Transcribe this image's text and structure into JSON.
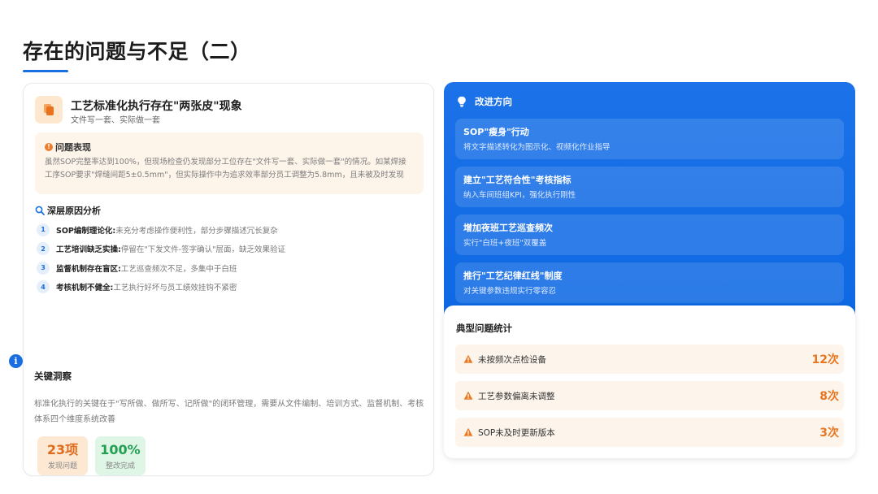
{
  "page": {
    "title": "存在的问题与不足（二）",
    "accent": "#1a6fe0"
  },
  "left_card": {
    "icon": "copy-files-icon",
    "title": "工艺标准化执行存在\"两张皮\"现象",
    "subtitle": "文件写一套、实际做一套",
    "problem": {
      "heading": "问题表现",
      "text": "虽然SOP完整率达到100%，但现场检查仍发现部分工位存在\"文件写一套、实际做一套\"的情况。如某焊接工序SOP要求\"焊缝间距5±0.5mm\"，但实际操作中为追求效率部分员工调整为5.8mm，且未被及时发现"
    },
    "analysis": {
      "heading": "深层原因分析",
      "items": [
        {
          "num": "1",
          "bold": "SOP编制理论化:",
          "desc": "未充分考虑操作便利性，部分步骤描述冗长复杂"
        },
        {
          "num": "2",
          "bold": "工艺培训缺乏实操:",
          "desc": "停留在\"下发文件-签字确认\"层面，缺乏效果验证"
        },
        {
          "num": "3",
          "bold": "监督机制存在盲区:",
          "desc": "工艺巡查频次不足，多集中于白班"
        },
        {
          "num": "4",
          "bold": "考核机制不健全:",
          "desc": "工艺执行好坏与员工绩效挂钩不紧密"
        }
      ]
    },
    "insight": {
      "title": "关键洞察",
      "text": "标准化执行的关键在于\"写所做、做所写、记所做\"的闭环管理，需要从文件编制、培训方式、监督机制、考核体系四个维度系统改善"
    },
    "stats": [
      {
        "value": "23项",
        "label": "发现问题",
        "color": "#e06a1c"
      },
      {
        "value": "100%",
        "label": "整改完成",
        "color": "#21a052"
      }
    ]
  },
  "improve": {
    "heading": "改进方向",
    "icon": "lightbulb-icon",
    "items": [
      {
        "title": "SOP\"瘦身\"行动",
        "desc": "将文字描述转化为图示化、视频化作业指导"
      },
      {
        "title": "建立\"工艺符合性\"考核指标",
        "desc": "纳入车间班组KPI，强化执行刚性"
      },
      {
        "title": "增加夜班工艺巡查频次",
        "desc": "实行\"白班+夜班\"双覆盖"
      },
      {
        "title": "推行\"工艺纪律红线\"制度",
        "desc": "对关键参数违规实行零容忍"
      }
    ]
  },
  "typical_stats": {
    "title": "典型问题统计",
    "rows": [
      {
        "label": "未按频次点检设备",
        "count": "12次"
      },
      {
        "label": "工艺参数偏离未调整",
        "count": "8次"
      },
      {
        "label": "SOP未及时更新版本",
        "count": "3次"
      }
    ]
  }
}
